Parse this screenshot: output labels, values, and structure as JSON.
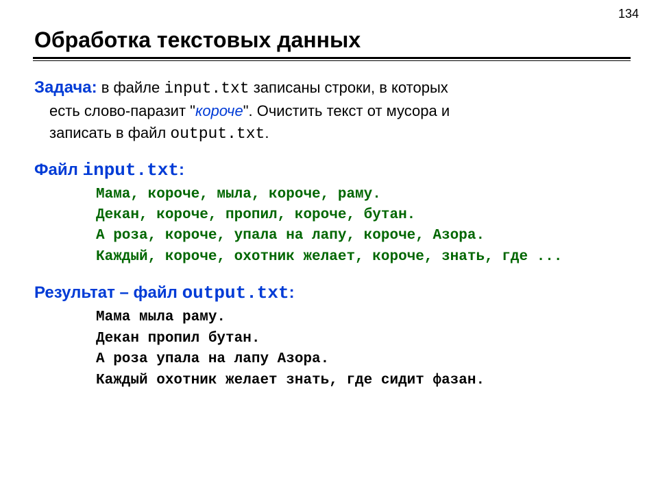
{
  "page_number": "134",
  "title": "Обработка текстовых данных",
  "task": {
    "label": "Задача:",
    "t1": " в файле ",
    "file_in": "input.txt",
    "t2": " записаны строки, в которых",
    "t3": "есть слово-паразит \"",
    "parasite": "короче",
    "t4": "\". Очистить текст от мусора и",
    "t5": "записать в файл ",
    "file_out": "output.txt",
    "t6": "."
  },
  "input_section": {
    "label_pre": "Файл ",
    "filename": "input.txt",
    "label_post": ":",
    "lines": [
      "Мама, короче, мыла, короче, раму.",
      "Декан, короче, пропил, короче, бутан.",
      "А роза, короче, упала на лапу, короче, Азора.",
      "Каждый, короче, охотник желает, короче, знать, где ..."
    ]
  },
  "output_section": {
    "label_pre": "Результат – файл ",
    "filename": "output.txt",
    "label_post": ":",
    "lines": [
      "Мама мыла раму.",
      "Декан пропил бутан.",
      "А роза упала на лапу Азора.",
      "Каждый охотник желает знать, где сидит фазан."
    ]
  }
}
